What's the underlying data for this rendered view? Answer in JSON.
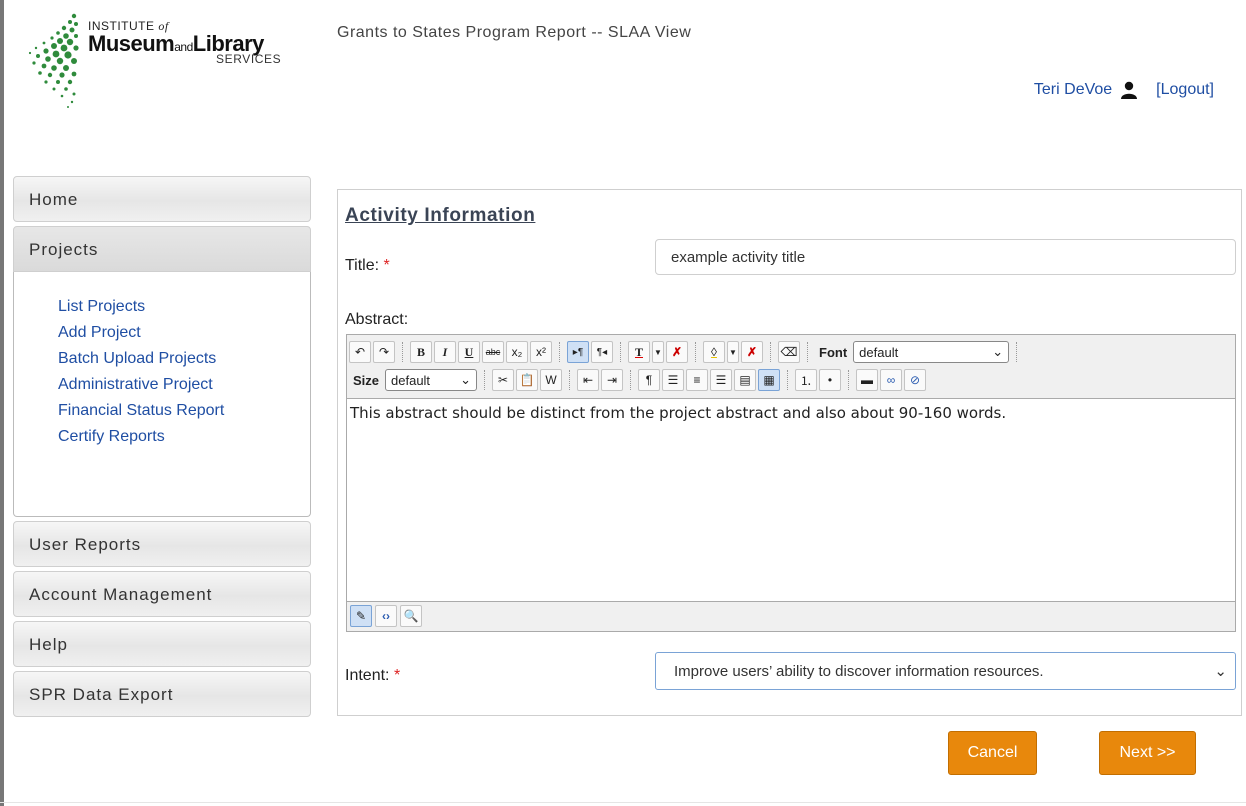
{
  "header": {
    "logo": {
      "line1": "INSTITUTE",
      "line1_of": "of",
      "museum": "Museum",
      "and": "and",
      "library": "Library",
      "services": "SERVICES"
    },
    "app_title": "Grants to States Program Report -- SLAA View",
    "user_name": "Teri DeVoe",
    "logout_label": "[Logout]"
  },
  "sidebar": {
    "home": "Home",
    "projects": "Projects",
    "project_links": [
      "List Projects",
      "Add Project",
      "Batch Upload Projects",
      "Administrative Project",
      "Financial Status Report",
      "Certify Reports"
    ],
    "user_reports": "User Reports",
    "account_management": "Account Management",
    "help": "Help",
    "spr_export": "SPR Data Export"
  },
  "form": {
    "section_title": "Activity Information",
    "title_label": "Title:",
    "title_value": "example activity title",
    "abstract_label": "Abstract:",
    "abstract_text": "This abstract should be distinct from the project abstract and also about 90-160 words.",
    "intent_label": "Intent:",
    "intent_value": "Improve users’ ability to discover information resources.",
    "required_marker": "*"
  },
  "editor": {
    "font_label": "Font",
    "font_value": "default",
    "size_label": "Size",
    "size_value": "default",
    "bold": "B",
    "italic": "I",
    "underline": "U",
    "strike": "abc",
    "textcolor": "T"
  },
  "buttons": {
    "cancel": "Cancel",
    "next": "Next >>"
  },
  "colors": {
    "accent": "#e8880c",
    "link": "#1f4ea3",
    "logo_green": "#2f8b3c"
  }
}
